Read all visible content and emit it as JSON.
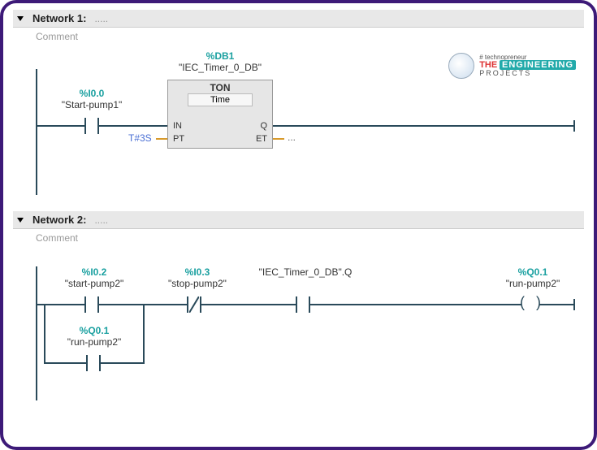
{
  "networks": [
    {
      "title": "Network 1:",
      "dots": ".....",
      "comment": "Comment",
      "db_addr": "%DB1",
      "db_name": "\"IEC_Timer_0_DB\"",
      "timer_type": "TON",
      "timer_sub": "Time",
      "pin_in": "IN",
      "pin_pt": "PT",
      "pin_q": "Q",
      "pin_et": "ET",
      "pt_value": "T#3S",
      "et_value": "...",
      "contacts": [
        {
          "addr": "%I0.0",
          "sym": "\"Start-pump1\""
        }
      ]
    },
    {
      "title": "Network 2:",
      "dots": ".....",
      "comment": "Comment",
      "timer_q_ref": "\"IEC_Timer_0_DB\".Q",
      "contacts": [
        {
          "addr": "%I0.2",
          "sym": "\"start-pump2\""
        },
        {
          "addr": "%I0.3",
          "sym": "\"stop-pump2\""
        }
      ],
      "parallel": {
        "addr": "%Q0.1",
        "sym": "\"run-pump2\""
      },
      "coil": {
        "addr": "%Q0.1",
        "sym": "\"run-pump2\""
      }
    }
  ],
  "watermark": {
    "techno": "# technopreneur",
    "the": "THE",
    "eng": "ENGINEERING",
    "proj": "PROJECTS"
  }
}
